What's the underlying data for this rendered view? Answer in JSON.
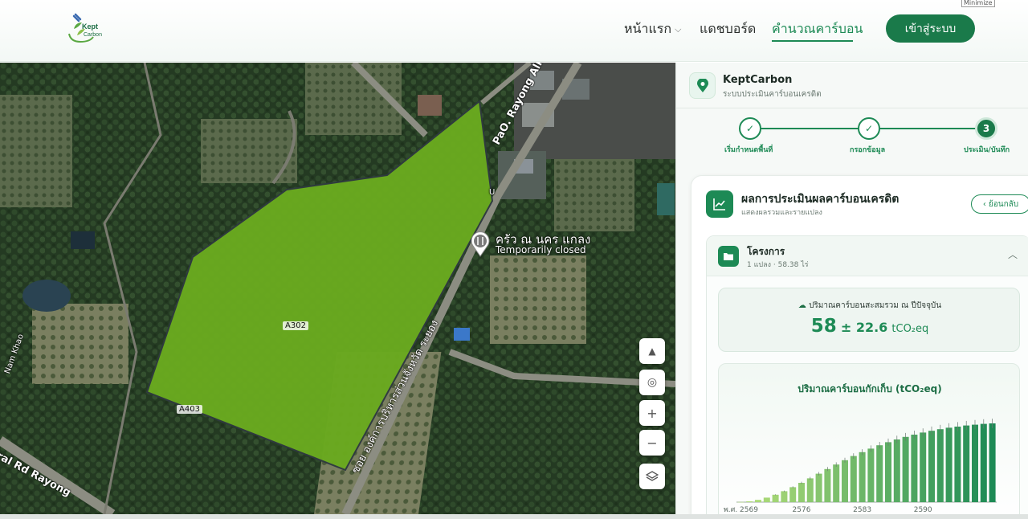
{
  "header": {
    "logo_text": "Kept Carbon",
    "nav": {
      "home": "หน้าแรก",
      "dashboard": "แดชบอร์ด",
      "calculator": "คำนวณคาร์บอน"
    },
    "login_button": "เข้าสู่ระบบ",
    "mini_tag": "Minimize"
  },
  "map": {
    "labels": {
      "road_top": "PaO. Rayong Alley",
      "road_main": "ซอย องค์การบริหารส่วนจังหวัด ระยอง",
      "road_left": "ral Rd Rayong",
      "road_edge": "Nam Khao",
      "u_marker": "U",
      "poi_name": "ครัว ณ นคร แกลง",
      "poi_status": "Temporarily closed"
    },
    "parcel_labels": {
      "a302": "A302",
      "a403": "A403"
    },
    "controls": {
      "compass": "compass-icon",
      "locate": "locate-icon",
      "zoom_in": "+",
      "zoom_out": "−",
      "layers": "layers-icon"
    },
    "colors": {
      "parcel": "#6aaa1f"
    }
  },
  "panel": {
    "brand": {
      "name": "KeptCarbon",
      "subtitle": "ระบบประเมินคาร์บอนเครดิต"
    },
    "steps": [
      {
        "label": "เริ่มกำหนดพื้นที่",
        "state": "done",
        "mark": "✓"
      },
      {
        "label": "กรอกข้อมูล",
        "state": "done",
        "mark": "✓"
      },
      {
        "label": "ประเมิน/บันทึก",
        "state": "active",
        "mark": "3"
      }
    ],
    "result": {
      "title": "ผลการประเมินผลคาร์บอนเครดิต",
      "subtitle": "แสดงผลรวมและรายแปลง",
      "back_label": "ย้อนกลับ",
      "project": {
        "title": "โครงการ",
        "meta": "1 แปลง · 58.38 ไร่"
      },
      "total": {
        "label": "ปริมาณคาร์บอนสะสมรวม ณ ปีปัจจุบัน",
        "value": "58",
        "pm": "± 22.6",
        "unit": "tCO₂eq"
      }
    }
  },
  "chart_data": {
    "type": "bar",
    "title": "ปริมาณคาร์บอนกักเก็บ (tCO₂eq)",
    "x_prefix": "พ.ศ.",
    "x_start": 2569,
    "x_end": 2598,
    "x_tick_labels": [
      "2569",
      "2576",
      "2583",
      "2590"
    ],
    "x_tick_values": [
      2569,
      2576,
      2583,
      2590
    ],
    "values": [
      0.1,
      0.5,
      1.4,
      2.8,
      4.6,
      6.8,
      9.3,
      12.0,
      14.8,
      17.7,
      20.6,
      23.4,
      26.1,
      28.7,
      31.1,
      33.3,
      35.4,
      37.3,
      39.0,
      40.6,
      42.0,
      43.3,
      44.4,
      45.4,
      46.3,
      47.0,
      47.7,
      48.2,
      48.7,
      49.0
    ],
    "error_bars": true,
    "ylim": [
      0,
      60
    ],
    "colors": {
      "early": "#b6e07a",
      "late": "#1d8a55"
    }
  }
}
